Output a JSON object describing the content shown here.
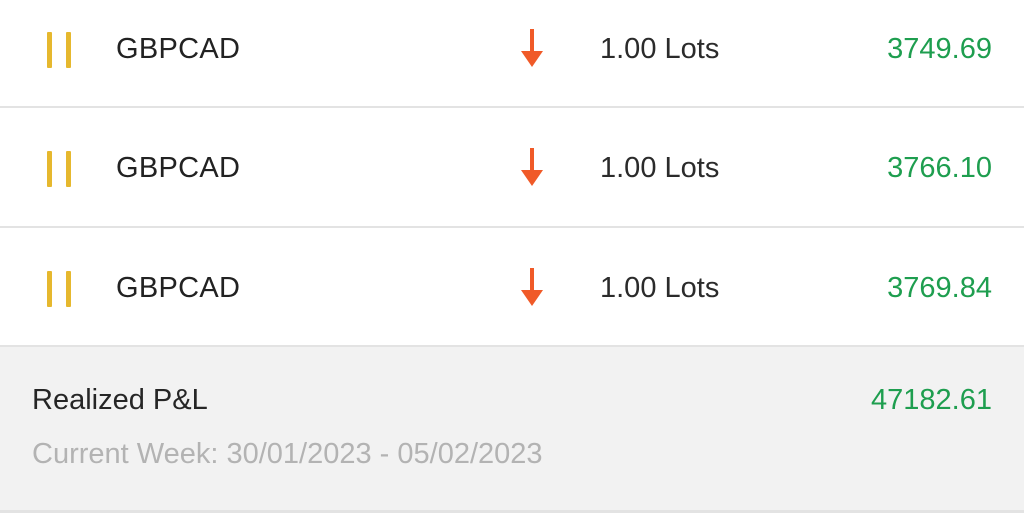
{
  "trades": [
    {
      "status_icon": "pause-icon",
      "symbol": "GBPCAD",
      "direction_icon": "arrow-down-icon",
      "lots": "1.00 Lots",
      "amount": "3749.69"
    },
    {
      "status_icon": "pause-icon",
      "symbol": "GBPCAD",
      "direction_icon": "arrow-down-icon",
      "lots": "1.00 Lots",
      "amount": "3766.10"
    },
    {
      "status_icon": "pause-icon",
      "symbol": "GBPCAD",
      "direction_icon": "arrow-down-icon",
      "lots": "1.00 Lots",
      "amount": "3769.84"
    }
  ],
  "summary": {
    "label": "Realized P&L",
    "value": "47182.61",
    "period": "Current Week: 30/01/2023 - 05/02/2023"
  },
  "colors": {
    "profit": "#1e9e4f",
    "pause": "#e6b82e",
    "sell_arrow": "#f05a28",
    "summary_background": "#f2f2f2"
  }
}
